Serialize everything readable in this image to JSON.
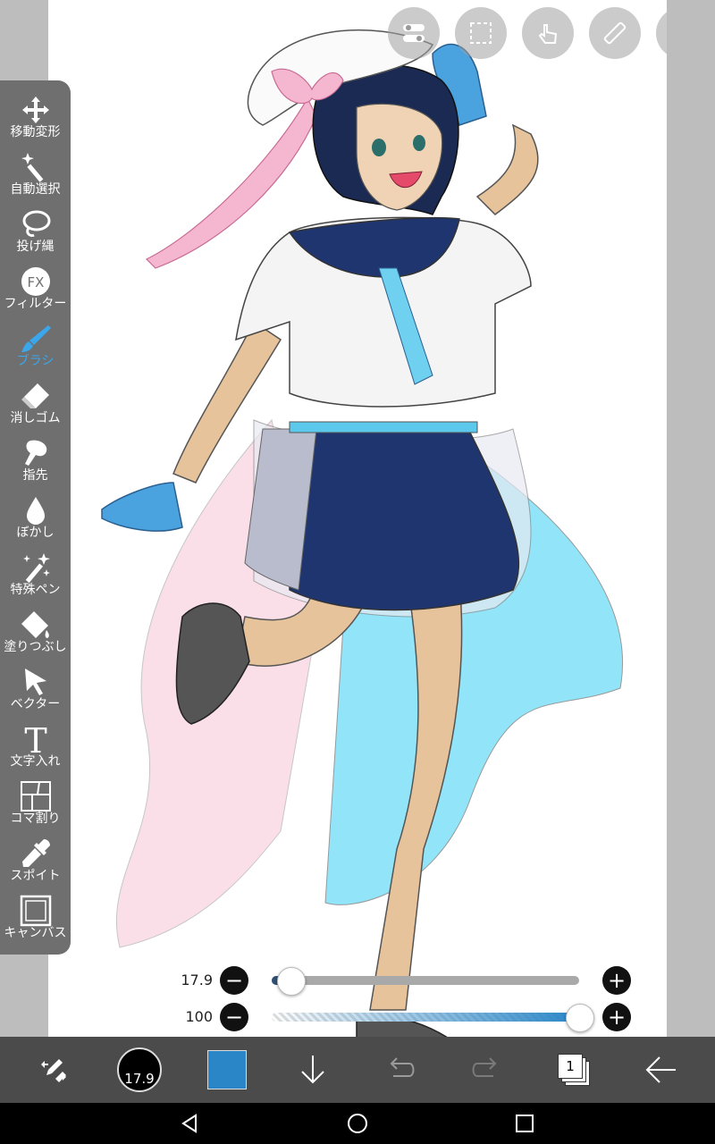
{
  "tools": [
    {
      "label": "移動変形",
      "icon": "move-transform-icon"
    },
    {
      "label": "自動選択",
      "icon": "magic-wand-icon"
    },
    {
      "label": "投げ縄",
      "icon": "lasso-icon"
    },
    {
      "label": "フィルター",
      "icon": "fx-filter-icon"
    },
    {
      "label": "ブラシ",
      "icon": "brush-icon",
      "active": true
    },
    {
      "label": "消しゴム",
      "icon": "eraser-icon"
    },
    {
      "label": "指先",
      "icon": "finger-smudge-icon"
    },
    {
      "label": "ぼかし",
      "icon": "blur-drop-icon"
    },
    {
      "label": "特殊ペン",
      "icon": "special-pen-icon"
    },
    {
      "label": "塗りつぶし",
      "icon": "bucket-fill-icon"
    },
    {
      "label": "ベクター",
      "icon": "vector-arrow-icon"
    },
    {
      "label": "文字入れ",
      "icon": "text-T-icon"
    },
    {
      "label": "コマ割り",
      "icon": "frame-divider-icon"
    },
    {
      "label": "スポイト",
      "icon": "eyedropper-icon"
    },
    {
      "label": "キャンバス",
      "icon": "canvas-icon"
    }
  ],
  "top_buttons": [
    "toggle-settings-icon",
    "selection-icon",
    "touch-gesture-icon",
    "ruler-icon",
    "image-material-icon"
  ],
  "sliders": {
    "size": {
      "value_label": "17.9",
      "fraction": 0.06
    },
    "opacity": {
      "value_label": "100",
      "fraction": 1.0
    }
  },
  "bottom_bar": {
    "brush_size_label": "17.9",
    "current_color": "#2a86c7",
    "layer_count": "1"
  },
  "colors": {
    "toolbar_bg": "#6f6f6f",
    "active_tool": "#3aa7ec",
    "bottom_bar_bg": "#4b4b4b",
    "size_track_fill": "#2f4f75",
    "opacity_track_fill": "#2a86c7"
  }
}
